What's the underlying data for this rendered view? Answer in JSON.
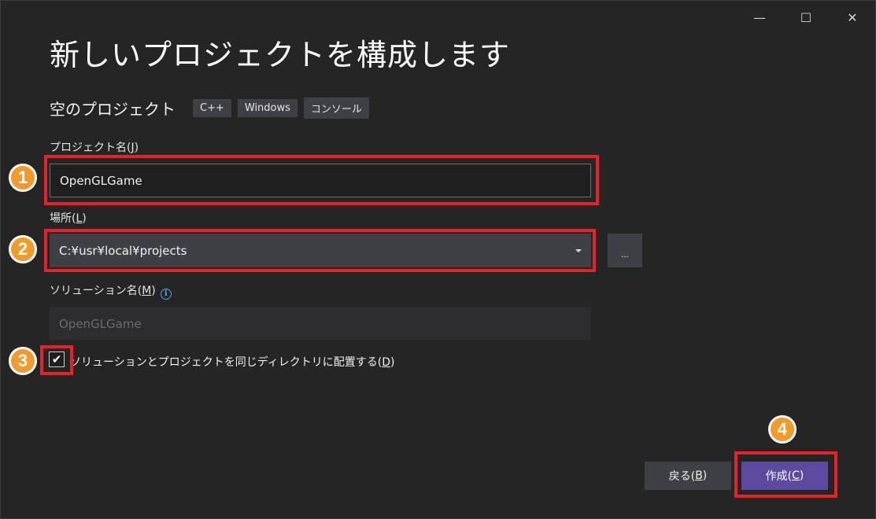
{
  "window": {
    "minimize_glyph": "—",
    "maximize_glyph": "☐",
    "close_glyph": "✕"
  },
  "title": "新しいプロジェクトを構成します",
  "template": {
    "name": "空のプロジェクト",
    "tags": [
      "C++",
      "Windows",
      "コンソール"
    ]
  },
  "project_name": {
    "label": "プロジェクト名(",
    "accesskey": "J",
    "label_end": ")",
    "value": "OpenGLGame"
  },
  "location": {
    "label": "場所(",
    "accesskey": "L",
    "label_end": ")",
    "value": "C:¥usr¥local¥projects",
    "browse_label": "..."
  },
  "solution_name": {
    "label": "ソリューション名(",
    "accesskey": "M",
    "label_end": ")",
    "info_glyph": "i",
    "placeholder": "OpenGLGame"
  },
  "same_directory": {
    "checked": true,
    "check_glyph": "✔",
    "label": "ソリューションとプロジェクトを同じディレクトリに配置する(",
    "accesskey": "D",
    "label_end": ")"
  },
  "buttons": {
    "back": {
      "label": "戻る(",
      "accesskey": "B",
      "label_end": ")"
    },
    "create": {
      "label": "作成(",
      "accesskey": "C",
      "label_end": ")"
    }
  },
  "annotations": [
    "1",
    "2",
    "3",
    "4"
  ],
  "colors": {
    "background": "#252526",
    "highlight": "#e8202a",
    "badge": "#f39a2b",
    "primary_button": "#5d4aa0"
  }
}
